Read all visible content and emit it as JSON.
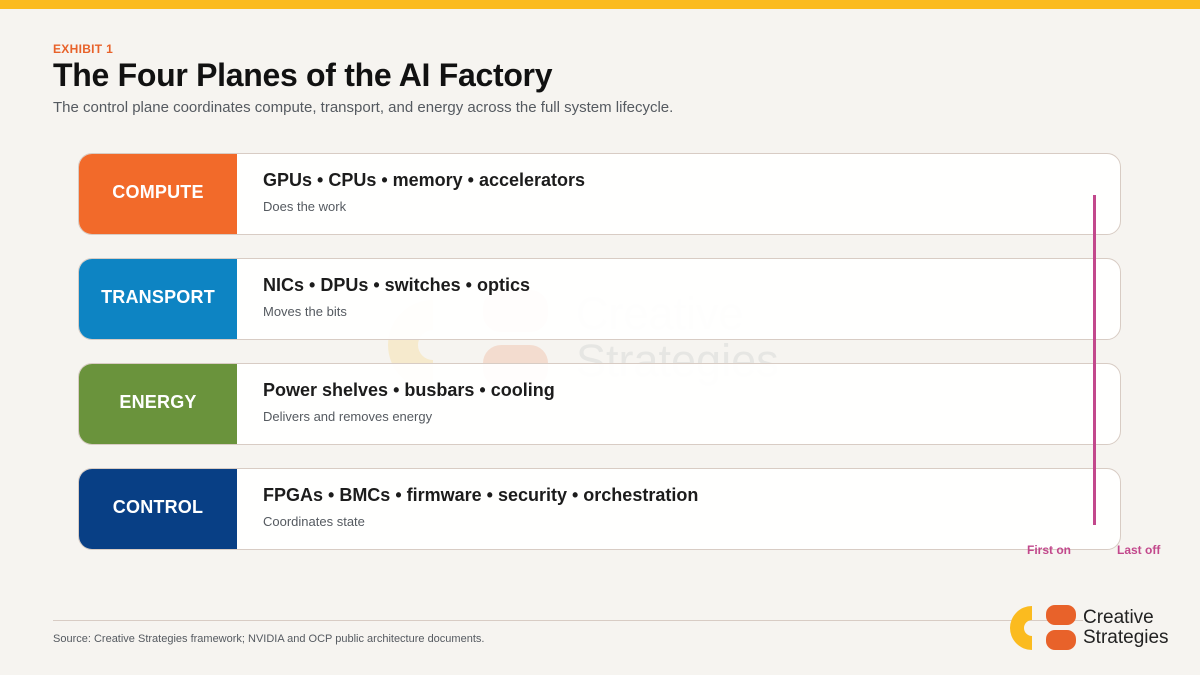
{
  "exhibit_label": "EXHIBIT 1",
  "title": "The Four Planes of the AI Factory",
  "subtitle": "The control plane coordinates compute, transport, and energy across the full system lifecycle.",
  "planes": [
    {
      "label": "COMPUTE",
      "items": "GPUs • CPUs • memory • accelerators",
      "description": "Does the work",
      "color": "#f26a2a"
    },
    {
      "label": "TRANSPORT",
      "items": "NICs • DPUs • switches • optics",
      "description": "Moves the bits",
      "color": "#0d84c3"
    },
    {
      "label": "ENERGY",
      "items": "Power shelves • busbars • cooling",
      "description": "Delivers and removes energy",
      "color": "#6a933c"
    },
    {
      "label": "CONTROL",
      "items": "FPGAs • BMCs • firmware • security • orchestration",
      "description": "Coordinates state",
      "color": "#083f85"
    }
  ],
  "timeline": {
    "start_label": "First on",
    "end_label": "Last off",
    "color": "#c2488c"
  },
  "footer": {
    "source": "Source: Creative Strategies framework; NVIDIA and OCP public architecture documents."
  },
  "brand": {
    "line1": "Creative",
    "line2": "Strategies"
  },
  "watermark": {
    "line1": "Creative",
    "line2": "Strategies"
  },
  "colors": {
    "accent_bar": "#fbbb1f",
    "exhibit": "#e8622a",
    "background": "#f6f4f0"
  }
}
